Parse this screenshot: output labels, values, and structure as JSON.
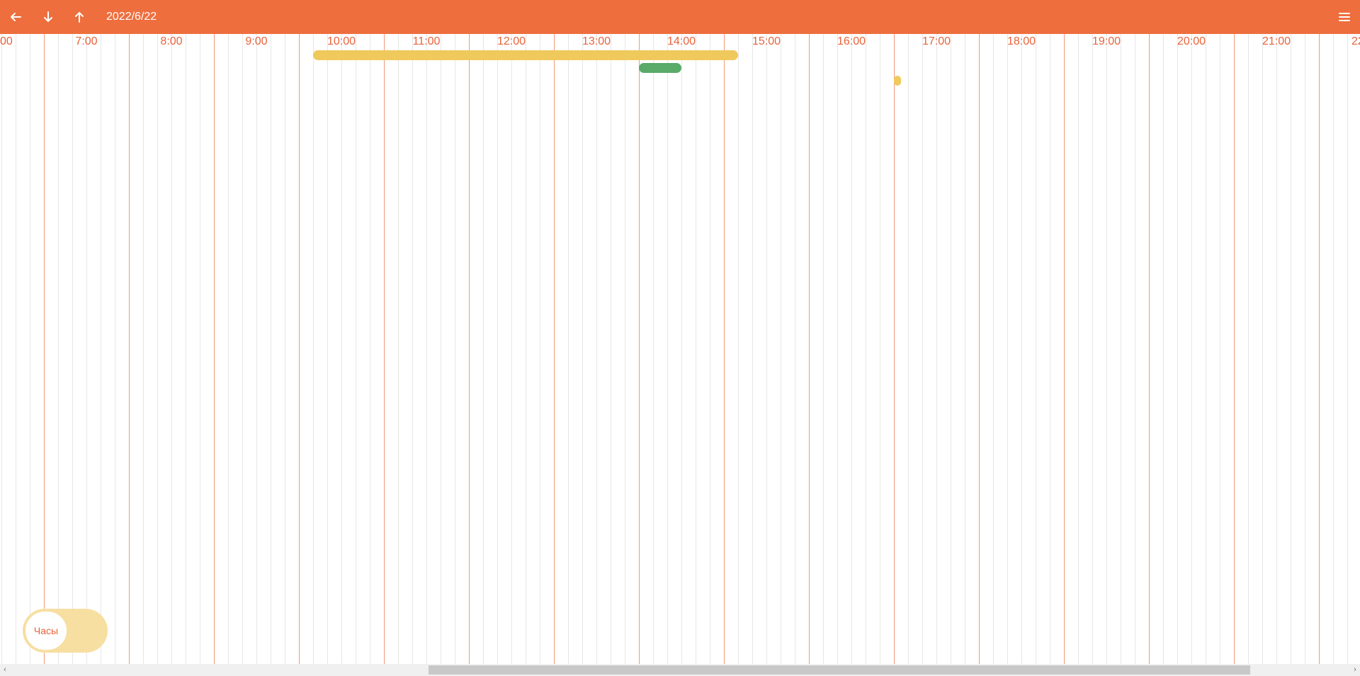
{
  "header": {
    "date": "2022/6/22",
    "back_icon": "arrow-left-icon",
    "down_icon": "arrow-down-icon",
    "up_icon": "arrow-up-icon",
    "menu_icon": "hamburger-menu-icon",
    "background_color": "#EE6E3E"
  },
  "timeline": {
    "hour_labels": [
      "00",
      "7:00",
      "8:00",
      "9:00",
      "10:00",
      "11:00",
      "12:00",
      "13:00",
      "14:00",
      "15:00",
      "16:00",
      "17:00",
      "18:00",
      "19:00",
      "20:00",
      "21:00",
      "22"
    ],
    "events": [
      {
        "start": "9:40",
        "end": "14:40",
        "color": "#F0C95C"
      },
      {
        "start": "13:30",
        "end": "14:00",
        "color": "#5AAA6A"
      },
      {
        "start": "16:30",
        "end": "16:35",
        "color": "#F0C95C"
      }
    ],
    "hour_line_color": "#F29A7A",
    "minor_line_color": "#e6e6e6",
    "label_color": "#E8633A"
  },
  "toggle": {
    "label": "Часы"
  },
  "scrollbar": {
    "left_arrow": "‹",
    "right_arrow": "›"
  }
}
